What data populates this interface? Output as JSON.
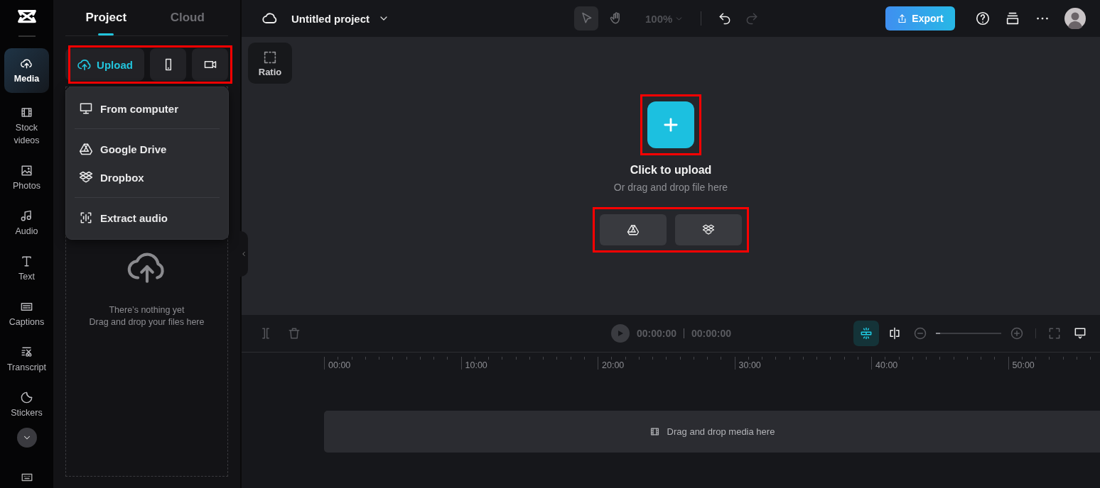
{
  "rail": {
    "items": [
      {
        "label": "Media",
        "kind": "cloud-upload",
        "selected": true
      },
      {
        "label": "Stock videos",
        "kind": "film",
        "selected": false
      },
      {
        "label": "Photos",
        "kind": "photo",
        "selected": false
      },
      {
        "label": "Audio",
        "kind": "music",
        "selected": false
      },
      {
        "label": "Text",
        "kind": "text",
        "selected": false
      },
      {
        "label": "Captions",
        "kind": "captions",
        "selected": false
      },
      {
        "label": "Transcript",
        "kind": "transcript",
        "selected": false
      },
      {
        "label": "Stickers",
        "kind": "sticker",
        "selected": false
      }
    ]
  },
  "panel": {
    "tabs": [
      {
        "label": "Project",
        "selected": true
      },
      {
        "label": "Cloud",
        "selected": false
      }
    ],
    "upload_button": {
      "label": "Upload"
    },
    "menu": {
      "groups": [
        [
          {
            "label": "From computer",
            "kind": "monitor"
          }
        ],
        [
          {
            "label": "Google Drive",
            "kind": "drive"
          },
          {
            "label": "Dropbox",
            "kind": "dropbox"
          }
        ],
        [
          {
            "label": "Extract audio",
            "kind": "audio-wave"
          }
        ]
      ]
    },
    "empty_state": {
      "title": "There’s nothing yet",
      "hint": "Drag and drop your files here"
    }
  },
  "top_bar": {
    "project_title": "Untitled project",
    "tools": [
      {
        "kind": "cursor",
        "selected": true
      },
      {
        "kind": "hand",
        "selected": false
      }
    ],
    "zoom": "100%",
    "actions": [
      {
        "kind": "undo",
        "disabled": false
      },
      {
        "kind": "redo",
        "disabled": true
      }
    ],
    "export_label": "Export"
  },
  "canvas": {
    "ratio_label": "Ratio",
    "upload_title": "Click to upload",
    "upload_hint": "Or drag and drop file here",
    "sources": [
      {
        "kind": "drive"
      },
      {
        "kind": "dropbox"
      }
    ]
  },
  "timeline": {
    "current_time": "00:00:00",
    "total_time": "00:00:00",
    "snap_on": true,
    "zoom": {
      "level": 0.07
    },
    "ruler": [
      "00:00",
      "10:00",
      "20:00",
      "30:00",
      "40:00",
      "50:00"
    ],
    "track_hint": "Drag and drop media here"
  }
}
